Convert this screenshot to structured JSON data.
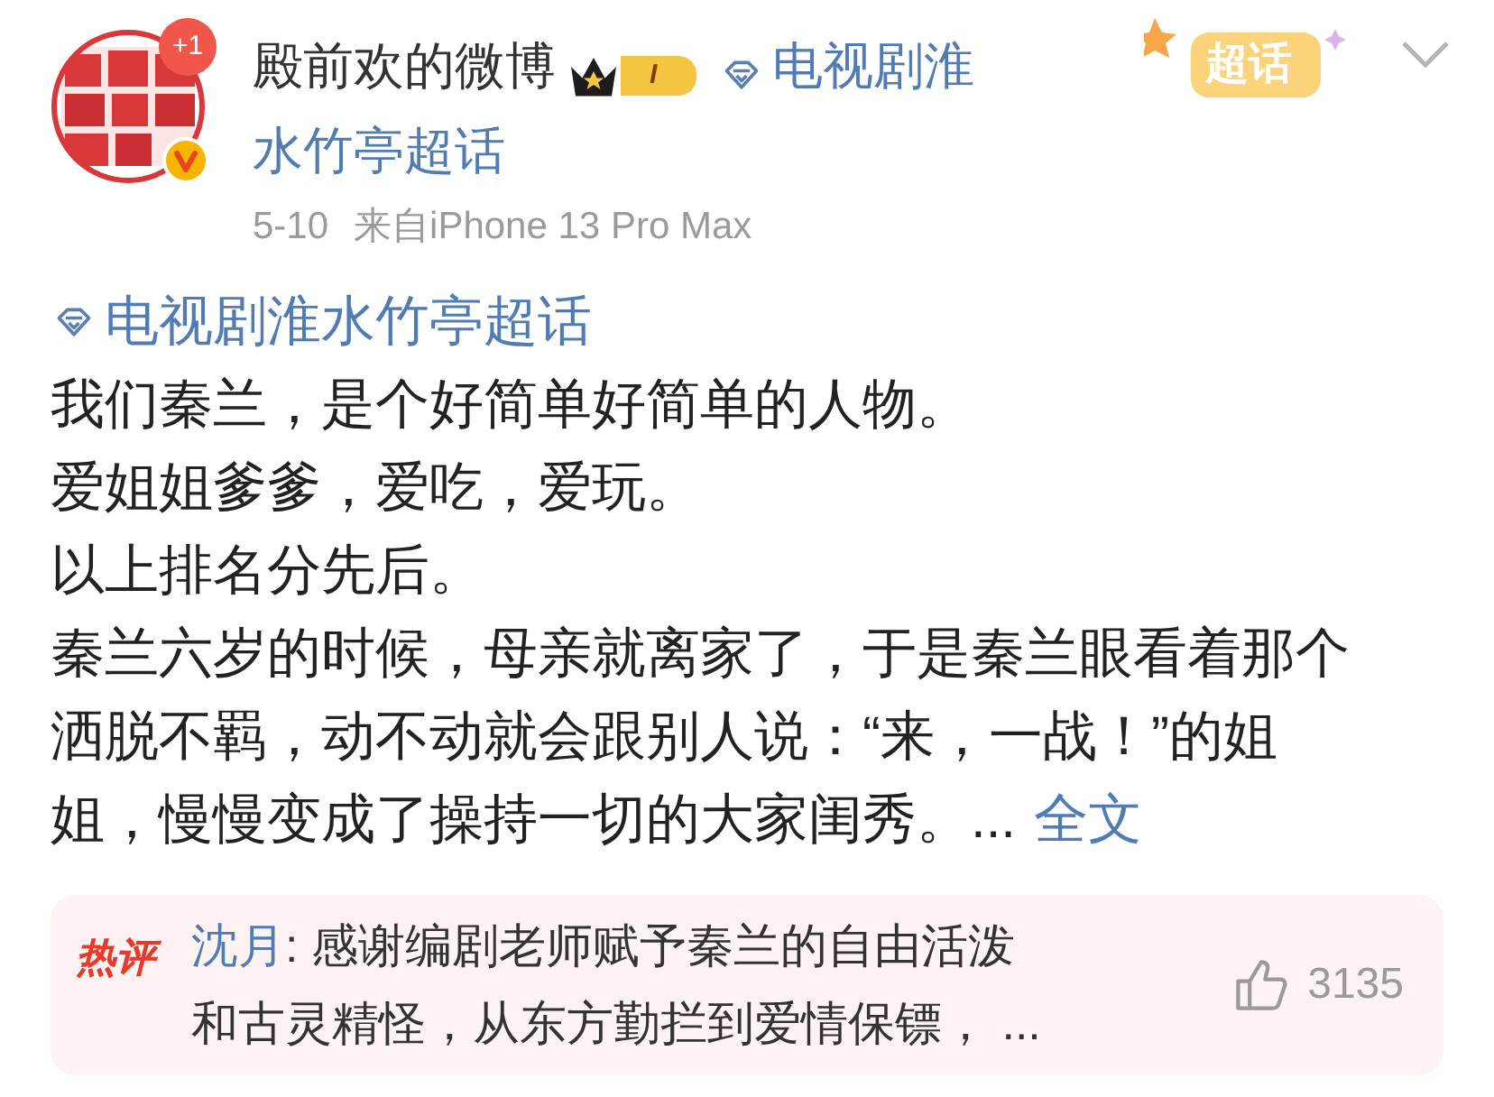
{
  "post": {
    "avatar": {
      "kind": "picture",
      "badge": "+1",
      "verified": true
    },
    "author": "殿前欢的微博",
    "member_level": "I",
    "topic_tag_lines": [
      "电视剧淮",
      "水竹亭超话"
    ],
    "supertopic_badge": "超话",
    "date": "5-10",
    "source": "来自iPhone 13 Pro Max"
  },
  "body": {
    "topic_link": "电视剧淮水竹亭超话",
    "lines": [
      "我们秦兰，是个好简单好简单的人物。",
      "爱姐姐爹爹，爱吃，爱玩。",
      "以上排名分先后。",
      "秦兰六岁的时候，母亲就离家了，于是秦兰眼看着那个",
      "洒脱不羁，动不动就会跟别人说：“来，一战！”的姐",
      "姐，慢慢变成了操持一切的大家闺秀。..."
    ],
    "more_link": "全文"
  },
  "hot_comment": {
    "label": "热评",
    "user": "沈月",
    "text_lines": [
      ": 感谢编剧老师赋予秦兰的自由活泼",
      "和古灵精怪，从东方勤拦到爱情保镖，  ..."
    ],
    "likes": "3135"
  }
}
